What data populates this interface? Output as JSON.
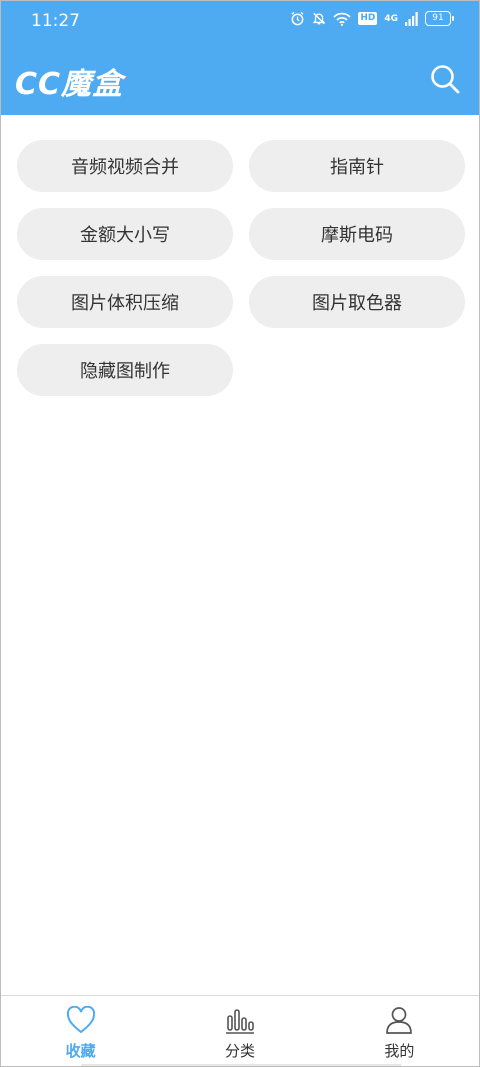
{
  "status": {
    "time": "11:27",
    "hd": "HD",
    "network": "4G",
    "battery": "91"
  },
  "app": {
    "title": "CC魔盒",
    "search_icon": "search-icon"
  },
  "tools": [
    {
      "label": "音频视频合并"
    },
    {
      "label": "指南针"
    },
    {
      "label": "金额大小写"
    },
    {
      "label": "摩斯电码"
    },
    {
      "label": "图片体积压缩"
    },
    {
      "label": "图片取色器"
    },
    {
      "label": "隐藏图制作"
    }
  ],
  "nav": {
    "items": [
      {
        "label": "收藏",
        "icon": "heart-icon",
        "active": true
      },
      {
        "label": "分类",
        "icon": "chart-bars-icon",
        "active": false
      },
      {
        "label": "我的",
        "icon": "user-icon",
        "active": false
      }
    ]
  },
  "colors": {
    "accent": "#4eaaf1",
    "button_bg": "#eeeeee",
    "text": "#333333"
  }
}
